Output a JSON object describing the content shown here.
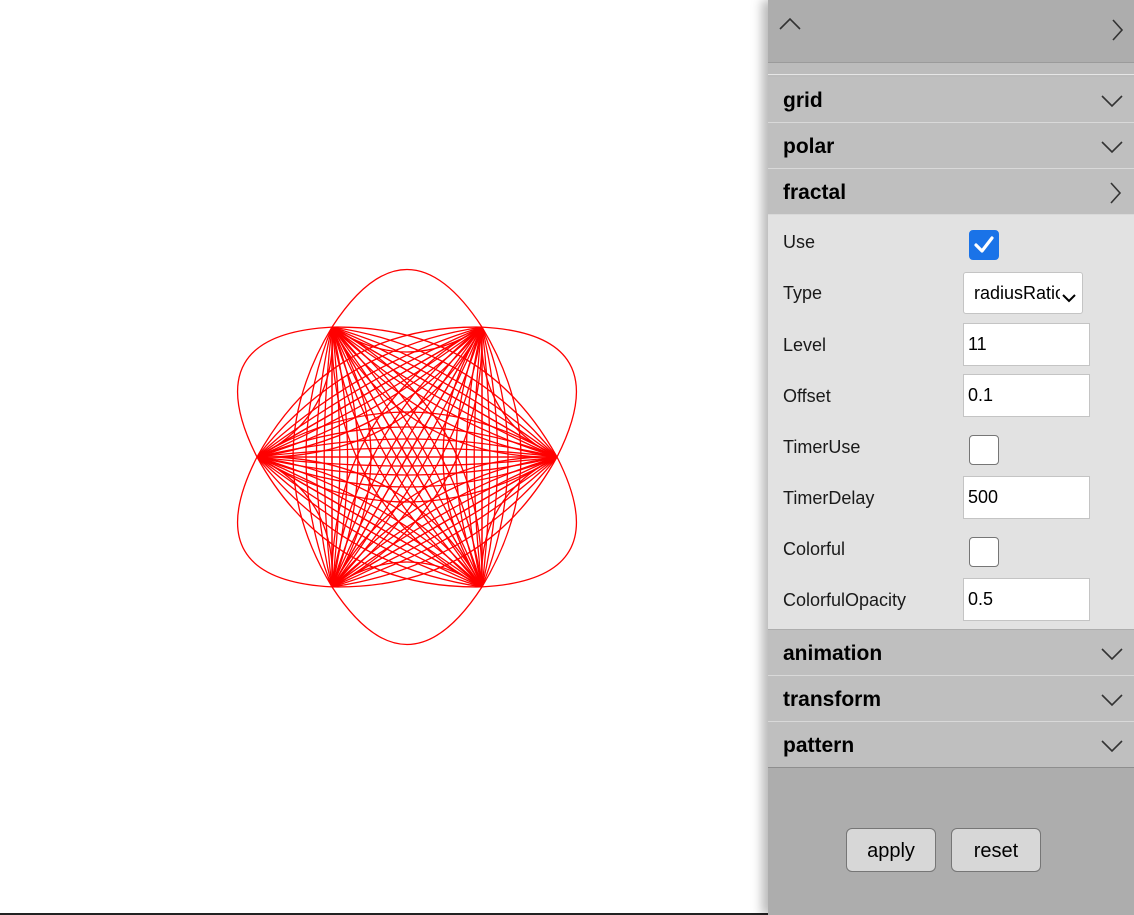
{
  "canvas": {
    "stroke_color": "#ff0000",
    "background": "#ffffff"
  },
  "panel": {
    "sections_top": [
      {
        "title": "grid",
        "state": "collapsed"
      },
      {
        "title": "polar",
        "state": "collapsed"
      }
    ],
    "fractal": {
      "title": "fractal",
      "state": "expanded",
      "fields": {
        "use": {
          "label": "Use",
          "checked": true
        },
        "type": {
          "label": "Type",
          "value": "radiusRatio"
        },
        "level": {
          "label": "Level",
          "value": "11"
        },
        "offset": {
          "label": "Offset",
          "value": "0.1"
        },
        "timer_use": {
          "label": "TimerUse",
          "checked": false
        },
        "timer_delay": {
          "label": "TimerDelay",
          "value": "500"
        },
        "colorful": {
          "label": "Colorful",
          "checked": false
        },
        "colorful_opacity": {
          "label": "ColorfulOpacity",
          "value": "0.5"
        }
      }
    },
    "sections_bottom": [
      {
        "title": "animation",
        "state": "collapsed"
      },
      {
        "title": "transform",
        "state": "collapsed"
      },
      {
        "title": "pattern",
        "state": "collapsed"
      }
    ],
    "buttons": {
      "apply": "apply",
      "reset": "reset"
    },
    "colors": {
      "panel_bg": "#adadad",
      "header_bg": "#bfbfbf",
      "body_bg": "#e2e2e2",
      "checkbox_accent": "#1a73e8"
    }
  }
}
